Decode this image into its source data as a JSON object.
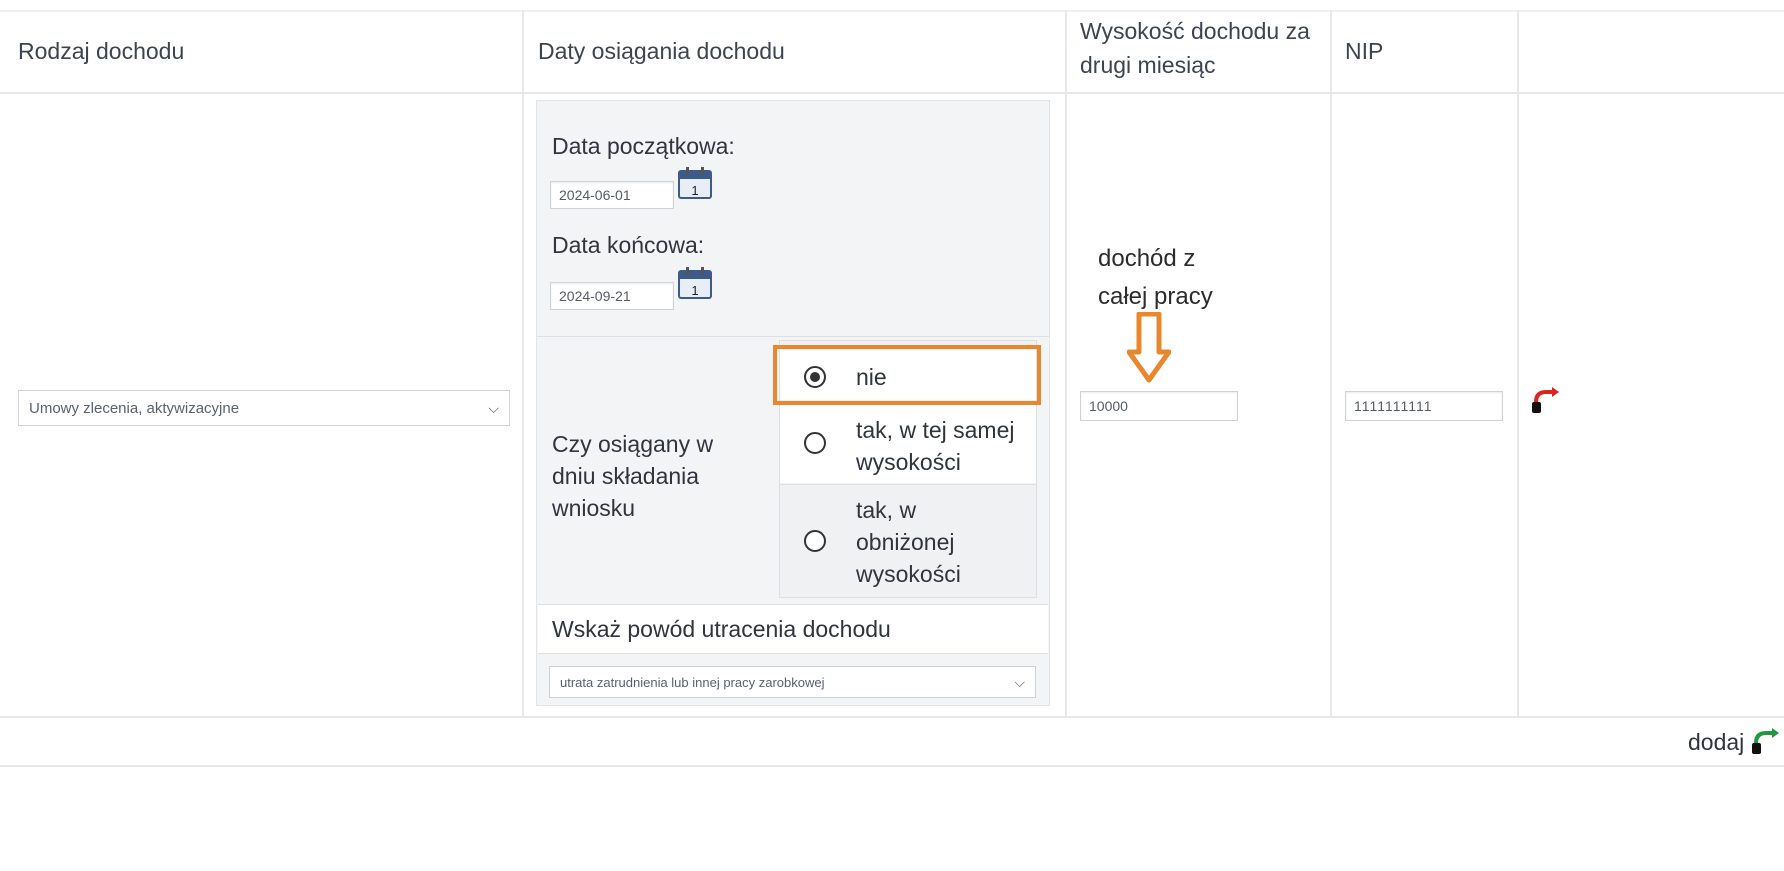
{
  "headers": {
    "col1": "Rodzaj dochodu",
    "col2": "Daty osiągania dochodu",
    "col3": "Wysokość dochodu za drugi miesiąc",
    "col4": "NIP"
  },
  "row": {
    "income_type": "Umowy zlecenia, aktywizacyjne",
    "start_label": "Data początkowa:",
    "start_value": "2024-06-01",
    "end_label": "Data końcowa:",
    "end_value": "2024-09-21",
    "question": "Czy osiągany w dniu składania wniosku",
    "options": [
      {
        "label": "nie",
        "selected": true
      },
      {
        "label": "tak, w tej samej wysokości",
        "selected": false
      },
      {
        "label": "tak, w obniżonej wysokości",
        "selected": false
      }
    ],
    "reason_label": "Wskaż powód utracenia dochodu",
    "reason_value": "utrata zatrudnienia lub innej pracy zarobkowej",
    "amount": "10000",
    "nip": "1111111111"
  },
  "annotation": {
    "text": "dochód z całej pracy",
    "color": "#e8872e"
  },
  "footer": {
    "add_label": "dodaj"
  },
  "icons": {
    "calendar": "calendar-icon",
    "delete": "remove-row-icon",
    "add": "add-row-icon"
  }
}
